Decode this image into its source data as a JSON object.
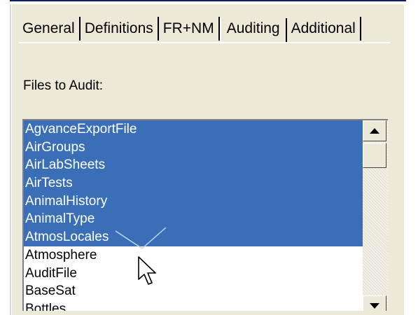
{
  "tabs": [
    {
      "label": "General",
      "active": false
    },
    {
      "label": "Definitions",
      "active": false
    },
    {
      "label": "FR+NM",
      "active": false
    },
    {
      "label": "Auditing",
      "active": true
    },
    {
      "label": "Additional",
      "active": false
    }
  ],
  "files_label": "Files to Audit:",
  "files": [
    {
      "name": "AgvanceExportFile",
      "selected": true
    },
    {
      "name": "AirGroups",
      "selected": true
    },
    {
      "name": "AirLabSheets",
      "selected": true
    },
    {
      "name": "AirTests",
      "selected": true
    },
    {
      "name": "AnimalHistory",
      "selected": true
    },
    {
      "name": "AnimalType",
      "selected": true
    },
    {
      "name": "AtmosLocales",
      "selected": true
    },
    {
      "name": "Atmosphere",
      "selected": false
    },
    {
      "name": "AuditFile",
      "selected": false
    },
    {
      "name": "BaseSat",
      "selected": false
    },
    {
      "name": "Bottles",
      "selected": false
    }
  ],
  "colors": {
    "dialog_bg": "#ece9d8",
    "selection": "#3a6fb8"
  },
  "icons": {
    "scroll_up": "triangle-up-icon",
    "scroll_down": "triangle-down-icon",
    "cursor": "mouse-pointer-icon"
  }
}
